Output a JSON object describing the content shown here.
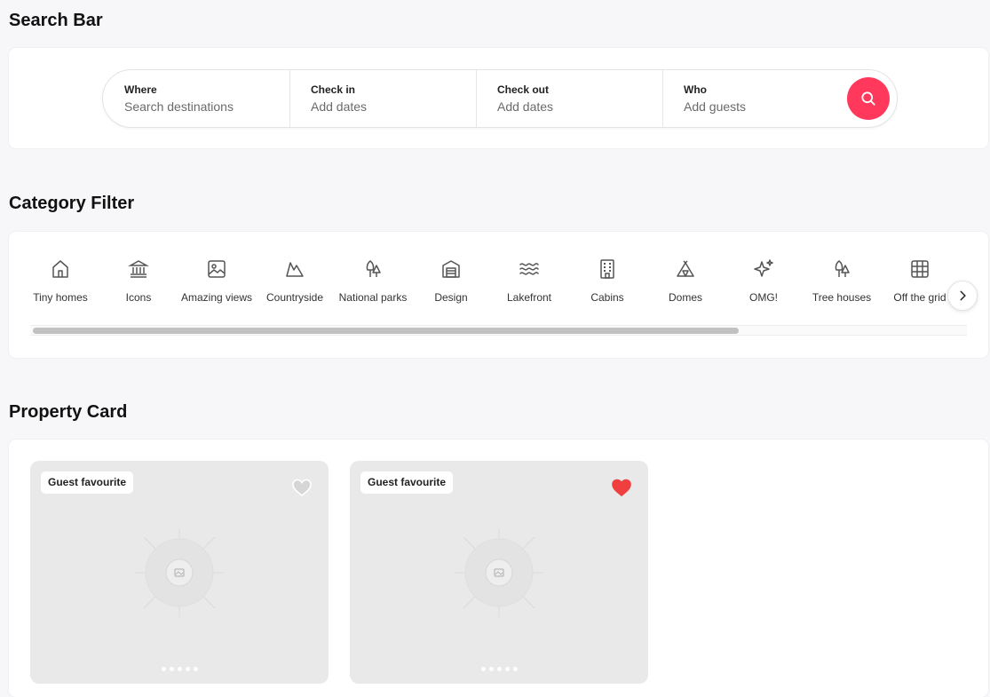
{
  "sections": {
    "search_bar_title": "Search Bar",
    "category_filter_title": "Category Filter",
    "property_card_title": "Property Card"
  },
  "search": {
    "where_label": "Where",
    "where_placeholder": "Search destinations",
    "checkin_label": "Check in",
    "checkin_value": "Add dates",
    "checkout_label": "Check out",
    "checkout_value": "Add dates",
    "who_label": "Who",
    "who_value": "Add guests",
    "button_icon": "search-icon",
    "accent_color": "#ff385c"
  },
  "categories": {
    "items": [
      {
        "label": "Tiny homes",
        "icon": "home-icon"
      },
      {
        "label": "Icons",
        "icon": "landmark-icon"
      },
      {
        "label": "Amazing views",
        "icon": "image-icon"
      },
      {
        "label": "Countryside",
        "icon": "mountain-icon"
      },
      {
        "label": "National parks",
        "icon": "trees-icon"
      },
      {
        "label": "Design",
        "icon": "building-design-icon"
      },
      {
        "label": "Lakefront",
        "icon": "waves-icon"
      },
      {
        "label": "Cabins",
        "icon": "building-icon"
      },
      {
        "label": "Domes",
        "icon": "tent-icon"
      },
      {
        "label": "OMG!",
        "icon": "sparkles-icon"
      },
      {
        "label": "Tree houses",
        "icon": "tree-icon"
      },
      {
        "label": "Off the grid",
        "icon": "grid-icon"
      }
    ],
    "next_icon": "chevron-right-icon"
  },
  "cards": [
    {
      "badge": "Guest favourite",
      "favorited": false,
      "heart_color": "#ffffff",
      "dots": 5
    },
    {
      "badge": "Guest favourite",
      "favorited": true,
      "heart_color": "#ef3f3f",
      "dots": 5
    }
  ]
}
